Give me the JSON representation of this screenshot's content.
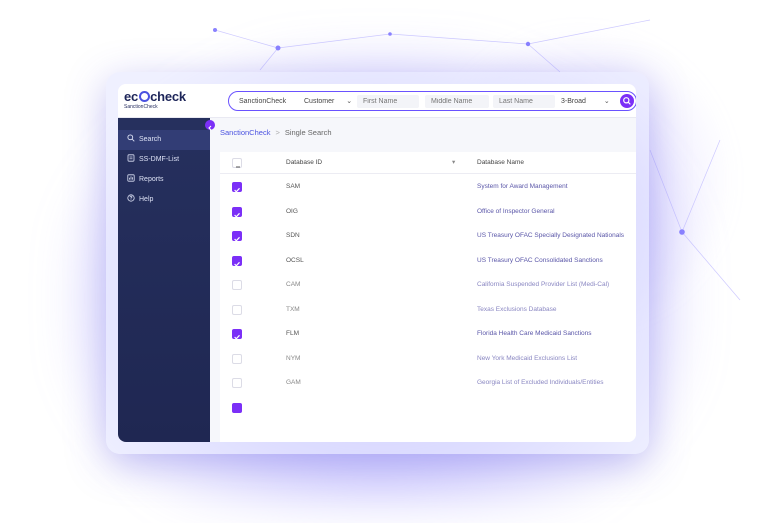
{
  "app": {
    "logo_text_prefix": "ec",
    "logo_text_suffix": "check",
    "logo_subtitle": "SanctionCheck"
  },
  "searchbar": {
    "product": "SanctionCheck",
    "type_value": "Customer",
    "first_name_placeholder": "First Name",
    "middle_name_placeholder": "Middle Name",
    "last_name_placeholder": "Last Name",
    "match_value": "3-Broad"
  },
  "sidebar": {
    "items": [
      {
        "label": "Search",
        "icon": "search-icon",
        "active": true
      },
      {
        "label": "SS-DMF-List",
        "icon": "document-icon",
        "active": false
      },
      {
        "label": "Reports",
        "icon": "report-icon",
        "active": false
      },
      {
        "label": "Help",
        "icon": "help-icon",
        "active": false
      }
    ]
  },
  "breadcrumb": {
    "root": "SanctionCheck",
    "separator": ">",
    "current": "Single Search"
  },
  "table": {
    "columns": {
      "id": "Database ID",
      "name": "Database Name"
    },
    "rows": [
      {
        "id": "SAM",
        "name": "System for Award Management",
        "checked": true
      },
      {
        "id": "OIG",
        "name": "Office of Inspector General",
        "checked": true
      },
      {
        "id": "SDN",
        "name": "US Treasury OFAC Specially Designated Nationals",
        "checked": true
      },
      {
        "id": "OCSL",
        "name": "US Treasury OFAC Consolidated Sanctions",
        "checked": true
      },
      {
        "id": "CAM",
        "name": "California Suspended Provider List (Medi-Cal)",
        "checked": false
      },
      {
        "id": "TXM",
        "name": "Texas Exclusions Database",
        "checked": false
      },
      {
        "id": "FLM",
        "name": "Florida Health Care Medicaid Sanctions",
        "checked": true
      },
      {
        "id": "NYM",
        "name": "New York Medicaid Exclusions List",
        "checked": false
      },
      {
        "id": "GAM",
        "name": "Georgia List of Excluded Individuals/Entities",
        "checked": false
      }
    ]
  },
  "colors": {
    "accent": "#7b2ff7",
    "brand_blue": "#4a52e0",
    "sidebar_bg": "#26305e"
  }
}
